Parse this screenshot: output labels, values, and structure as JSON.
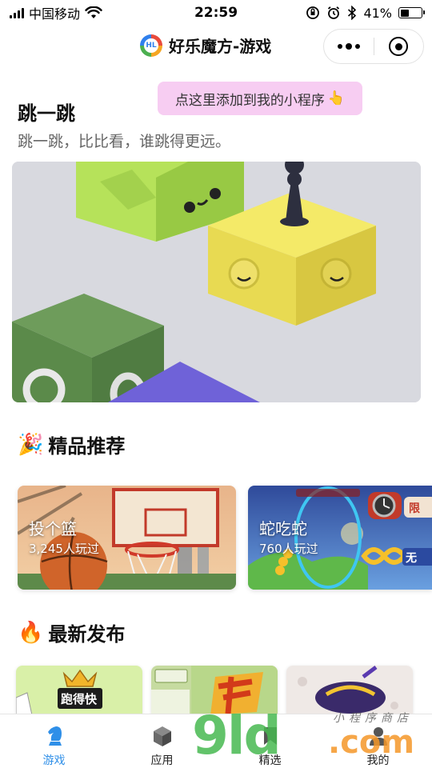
{
  "status_bar": {
    "carrier": "中国移动",
    "time": "22:59",
    "battery_text": "41%",
    "battery_level": 0.41
  },
  "nav": {
    "logo_text": "HL",
    "title": "好乐魔方-游戏"
  },
  "tip": {
    "text": "点这里添加到我的小程序",
    "emoji": "👆"
  },
  "featured": {
    "title": "跳一跳",
    "description": "跳一跳，比比看，谁跳得更远。"
  },
  "sections": {
    "recommended": {
      "icon": "🎉",
      "title": "精品推荐"
    },
    "latest": {
      "icon": "🔥",
      "title": "最新发布"
    }
  },
  "recommended_games": [
    {
      "name": "投个篮",
      "players": "3,245人玩过"
    },
    {
      "name": "蛇吃蛇",
      "players": "760人玩过"
    }
  ],
  "latest_games": [
    {
      "label": "跑得快"
    },
    {
      "label": ""
    },
    {
      "label": ""
    }
  ],
  "tabs": [
    {
      "label": "游戏",
      "icon": "chess-knight-icon",
      "active": true
    },
    {
      "label": "应用",
      "icon": "cube-icon",
      "active": false
    },
    {
      "label": "精选",
      "icon": "bookmark-icon",
      "active": false
    },
    {
      "label": "我的",
      "icon": "user-icon",
      "active": false
    }
  ],
  "watermark": {
    "big": "9ld",
    "com": ".com",
    "small": "小程序商店"
  },
  "colors": {
    "accent": "#2f8fe8",
    "tip_bg": "#f7cdf2"
  }
}
